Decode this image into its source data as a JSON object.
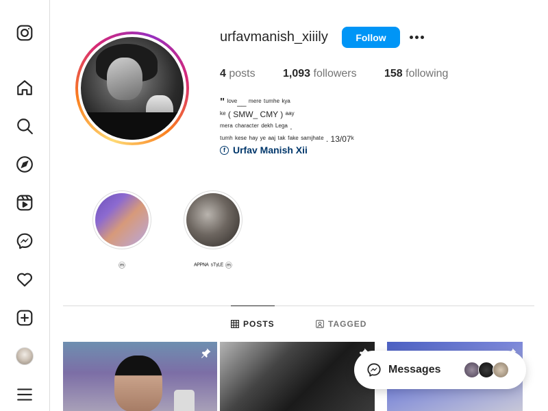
{
  "profile": {
    "username": "urfavmanish_xiiily",
    "follow_label": "Follow",
    "stats": {
      "posts_count": "4",
      "posts_label": "posts",
      "followers_count": "1,093",
      "followers_label": "followers",
      "following_count": "158",
      "following_label": "following"
    },
    "bio": {
      "quote_mark": "\"",
      "line1": " ˡᵒᵛᵉ__ ᵐᵉʳᵉ ᵗᵘᵐʰᵉ ᵏʸᵃ",
      "line2": "ᵏᵉ ( SMW_ CMY ) ᵃᵃʸ",
      "line3": "ᵐᵉʳᵃ ᶜʰᵃʳᵃᶜᵗᵉʳ ᵈᵉᵏʰ ᴸᵉᵍᵃ .",
      "line4": "ᵗᵘᵐʰ ᵏᵉˢᵉ ʰᵃʸ ʸᵉ ᵃᵃʲ ᵗᵃᵏ ᶠᵃᵏᵉ ˢᵃᵐʲʰᵃᵗᵉ . 13/07ᵏ"
    },
    "link_icon_glyph": "f",
    "link_text": "Urfav Manish Xii"
  },
  "highlights": [
    {
      "label": "ⓜ"
    },
    {
      "label": "ᴬᴾᴾᴺᴬ ˢᵀᵞᴸᴱ ⓜ"
    }
  ],
  "tabs": [
    {
      "label": "POSTS",
      "active": true
    },
    {
      "label": "TAGGED",
      "active": false
    }
  ],
  "messages": {
    "label": "Messages"
  },
  "sidebar": {
    "items": [
      {
        "name": "instagram",
        "icon": "instagram-logo-icon"
      },
      {
        "name": "home",
        "icon": "home-icon"
      },
      {
        "name": "search",
        "icon": "search-icon"
      },
      {
        "name": "explore",
        "icon": "compass-icon"
      },
      {
        "name": "reels",
        "icon": "reels-icon"
      },
      {
        "name": "messenger",
        "icon": "messenger-icon"
      },
      {
        "name": "notifications",
        "icon": "heart-icon"
      },
      {
        "name": "create",
        "icon": "plus-square-icon"
      },
      {
        "name": "profile",
        "icon": "profile-avatar-icon"
      },
      {
        "name": "more",
        "icon": "menu-icon"
      }
    ]
  },
  "colors": {
    "accent": "#0095f6",
    "link": "#00376b",
    "text": "#262626",
    "secondary_text": "#737373",
    "border": "#dbdbdb"
  }
}
